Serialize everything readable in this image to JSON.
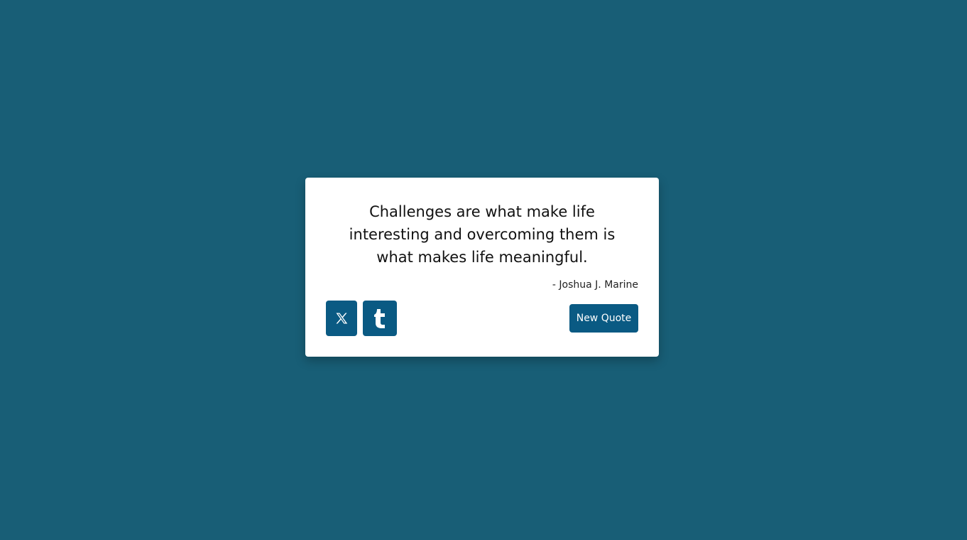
{
  "colors": {
    "background": "#185e76",
    "card": "#ffffff",
    "accent": "#0a5a83"
  },
  "quote": {
    "text": "Challenges are what make life interesting and overcoming them is what makes life meaningful.",
    "author": "- Joshua J. Marine"
  },
  "actions": {
    "share_x_icon": "x-logo-icon",
    "share_tumblr_icon": "tumblr-logo-icon",
    "new_quote_label": "New Quote"
  }
}
